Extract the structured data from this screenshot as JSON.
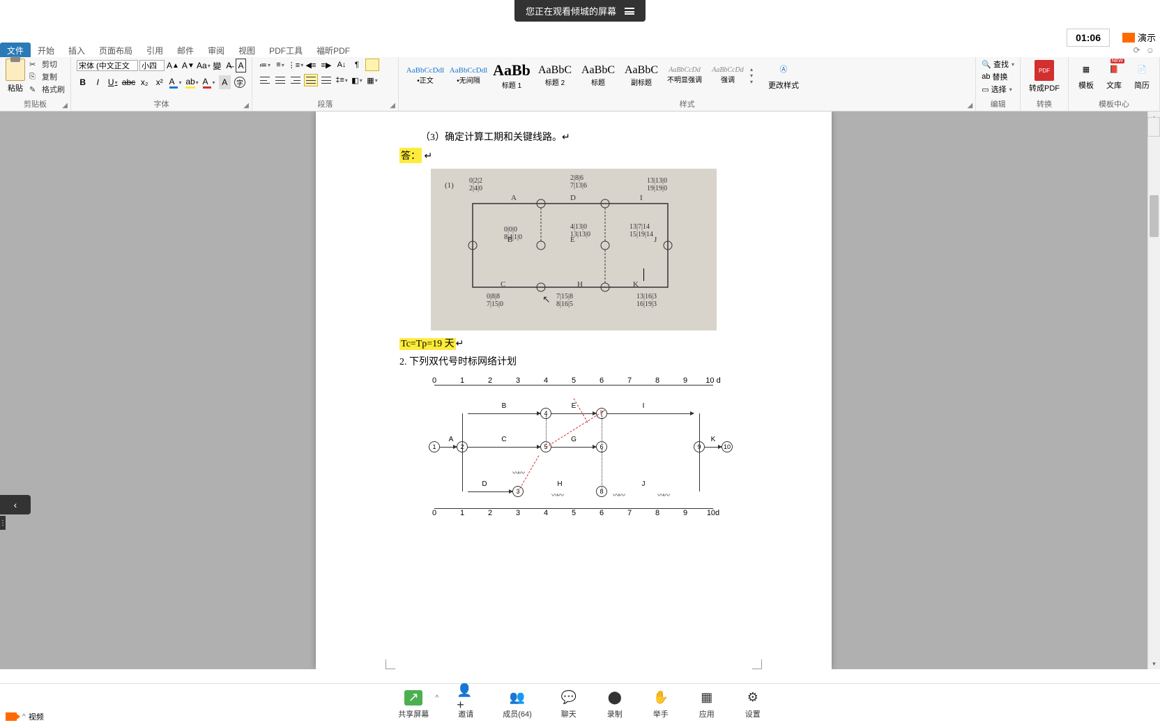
{
  "share_notice": "您正在观看倾城的屏幕",
  "time": "01:06",
  "present_label": "演示",
  "tabs": [
    "文件",
    "开始",
    "插入",
    "页面布局",
    "引用",
    "邮件",
    "审阅",
    "视图",
    "PDF工具",
    "福昕PDF"
  ],
  "active_tab_index": 0,
  "ribbon": {
    "clipboard": {
      "label": "剪贴板",
      "paste": "粘贴",
      "cut": "剪切",
      "copy": "复制",
      "format_painter": "格式刷"
    },
    "font": {
      "label": "字体",
      "family": "宋体 (中文正文",
      "size": "小四",
      "aa_tip": "Aa"
    },
    "paragraph": {
      "label": "段落"
    },
    "styles": {
      "label": "样式",
      "items": [
        {
          "preview": "AaBbCcDdl",
          "name": "•正文",
          "cls": "style-small"
        },
        {
          "preview": "AaBbCcDdl",
          "name": "•无间隔",
          "cls": "style-small"
        },
        {
          "preview": "AaBb",
          "name": "标题 1",
          "cls": "style-big"
        },
        {
          "preview": "AaBbC",
          "name": "标题 2",
          "cls": "style-med"
        },
        {
          "preview": "AaBbC",
          "name": "标题",
          "cls": "style-med"
        },
        {
          "preview": "AaBbC",
          "name": "副标题",
          "cls": "style-med"
        },
        {
          "preview": "AaBbCcDd",
          "name": "不明显强调",
          "cls": "style-gray"
        },
        {
          "preview": "AaBbCcDd",
          "name": "强调",
          "cls": "style-gray"
        }
      ],
      "change": "更改样式"
    },
    "editing": {
      "label": "编辑",
      "find": "查找",
      "replace": "替换",
      "select": "选择"
    },
    "convert": {
      "label": "转换",
      "to_pdf": "转成PDF"
    },
    "template": {
      "label": "模板中心",
      "tpl": "模板",
      "lib": "文库",
      "resume": "简历"
    }
  },
  "document": {
    "line1": "（3）确定计算工期和关键线路。",
    "answer": "答：",
    "formula": "Tc=Tp=19 天",
    "line2": "2.  下列双代号时标网络计划",
    "scale": [
      "0",
      "1",
      "2",
      "3",
      "4",
      "5",
      "6",
      "7",
      "8",
      "9",
      "10 d"
    ],
    "scale2": [
      "0",
      "1",
      "2",
      "3",
      "4",
      "5",
      "6",
      "7",
      "8",
      "9",
      "10d"
    ],
    "nodes": [
      "1",
      "2",
      "3",
      "4",
      "5",
      "6",
      "7",
      "8",
      "9",
      "10"
    ],
    "activities": {
      "A": "A",
      "B": "B",
      "C": "C",
      "D": "D",
      "E": "E",
      "G": "G",
      "H": "H",
      "I": "I",
      "J": "J",
      "K": "K"
    },
    "hw": {
      "marker": "(1)",
      "top1": "0|2|2\n2|4|0",
      "topA": "A",
      "top2": "2|8|6\n7|13|6",
      "topD": "D",
      "top3": "13|13|0\n19|19|0",
      "topI": "I",
      "mid1": "0|0|0\n8|4|1|0",
      "midB": "B",
      "mid2": "4|13|0\n13|13|0",
      "midE": "E",
      "mid3": "13|7|14\n15|19|14",
      "midJ": "J",
      "bot1": "0|8|8\n7|15|0",
      "botC": "C",
      "bot2": "7|15|8\n8|16|5",
      "botH": "H",
      "bot3": "13|16|3\n16|19|3",
      "botK": "K"
    }
  },
  "meeting": {
    "video": "视频",
    "share": "共享屏幕",
    "invite": "邀请",
    "members": "成员(64)",
    "chat": "聊天",
    "record": "录制",
    "raise": "举手",
    "apps": "应用",
    "settings": "设置"
  }
}
